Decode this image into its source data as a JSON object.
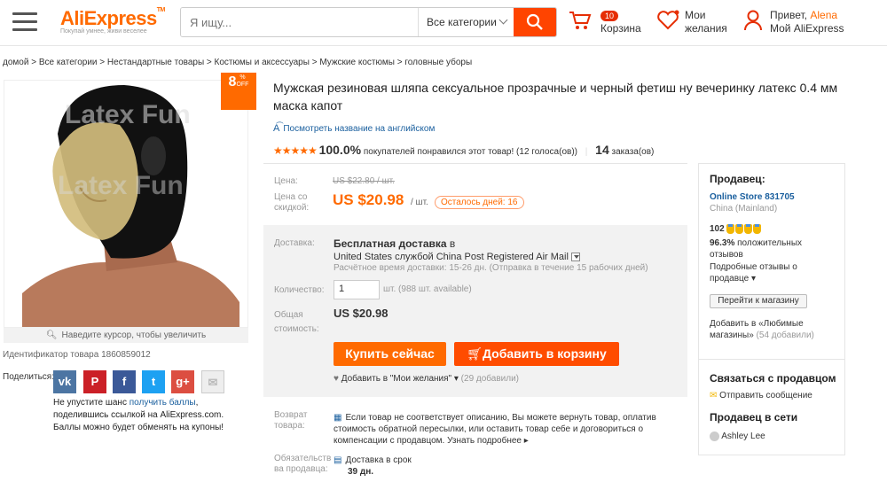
{
  "header": {
    "logo": "AliExpress",
    "logo_tm": "TM",
    "tagline": "Покупай умнее, живи веселее",
    "search_placeholder": "Я ищу...",
    "category": "Все категории",
    "cart_count": "10",
    "cart_label": "Корзина",
    "wishlist_label": "Мои желания",
    "greeting": "Привет,",
    "user_name": "Alena",
    "account_label": "Мой AliExpress"
  },
  "breadcrumb": "домой > Все категории > Нестандартные товары > Костюмы и аксессуары > Мужские костюмы > головные уборы",
  "gallery": {
    "discount": "8",
    "discount_unit": "%",
    "discount_word": "OFF",
    "zoom_hint": "Наведите курсор, чтобы увеличить",
    "watermark": "Latex Fun",
    "product_id": "Идентификатор товара 1860859012"
  },
  "share": {
    "label": "Поделиться:",
    "text_before": "Не упустите шанс",
    "link": "получить баллы",
    "text_after": ", поделившись ссылкой на AliExpress.com. Баллы можно будет обменять на купоны!"
  },
  "product": {
    "title": "Мужская резиновая шляпа сексуальное прозрачные и черный фетиш ну вечеринку латекс 0.4 мм маска капот",
    "english_link": "Посмотреть название на английском",
    "rating_pct": "100.0%",
    "rating_text": "покупателей понравился этот товар!",
    "votes": "(12 голоса(ов))",
    "orders_num": "14",
    "orders_word": "заказа(ов)",
    "price_label": "Цена:",
    "old_price": "US $22.80 / шт.",
    "sale_label_1": "Цена со",
    "sale_label_2": "скидкой:",
    "new_price": "US $20.98",
    "unit": "/ шт.",
    "days_left": "Осталось дней: 16",
    "ship_label": "Доставка:",
    "ship_free": "Бесплатная доставка",
    "ship_in": "в",
    "ship_country": "United States службой China Post Registered Air Mail",
    "ship_time": "Расчётное время доставки: 15-26 дн. (Отправка в течение 15 рабочих дней)",
    "qty_label": "Количество:",
    "qty_value": "1",
    "qty_available": "шт. (988 шт. available)",
    "total_label_1": "Общая",
    "total_label_2": "стоимость:",
    "total": "US $20.98",
    "buy_now": "Купить сейчас",
    "add_to_cart": "Добавить в корзину",
    "wishlist_add": "Добавить в \"Мои желания\"",
    "wishlist_count": "(29 добавили)",
    "return_label_1": "Возврат",
    "return_label_2": "товара:",
    "return_text": "Если товар не соответствует описанию, Вы можете вернуть товар, оплатив стоимость обратной пересылки, или оставить товар себе и договориться о компенсации с продавцом.",
    "return_more": "Узнать подробнее",
    "obl_label_1": "Обязательств",
    "obl_label_2": "ва продавца:",
    "delivery_promise": "Доставка в срок",
    "delivery_days": "39 дн."
  },
  "seller": {
    "heading": "Продавец:",
    "store": "Online Store 831705",
    "country": "China (Mainland)",
    "score": "102",
    "positive_pct": "96.3%",
    "positive_text_1": "положительных",
    "positive_text_2": "отзывов",
    "details_1": "Подробные отзывы о",
    "details_2": "продавце",
    "go_store": "Перейти к магазину",
    "fav_1": "Добавить в «Любимые",
    "fav_2": "магазины»",
    "fav_count": "(54 добавили)",
    "contact_heading": "Связаться с продавцом",
    "send_message": "Отправить сообщение",
    "online_heading": "Продавец в сети",
    "online_name": "Ashley Lee"
  },
  "colors": {
    "accent": "#ff6a00",
    "link": "#1a5f9e",
    "search_btn": "#ff4400"
  },
  "icons": [
    "menu-icon",
    "search-icon",
    "cart-icon",
    "heart-icon",
    "user-icon",
    "translate-icon",
    "star-icon",
    "heart-small-icon",
    "return-icon",
    "calendar-icon",
    "mail-icon",
    "dropdown-icon"
  ]
}
